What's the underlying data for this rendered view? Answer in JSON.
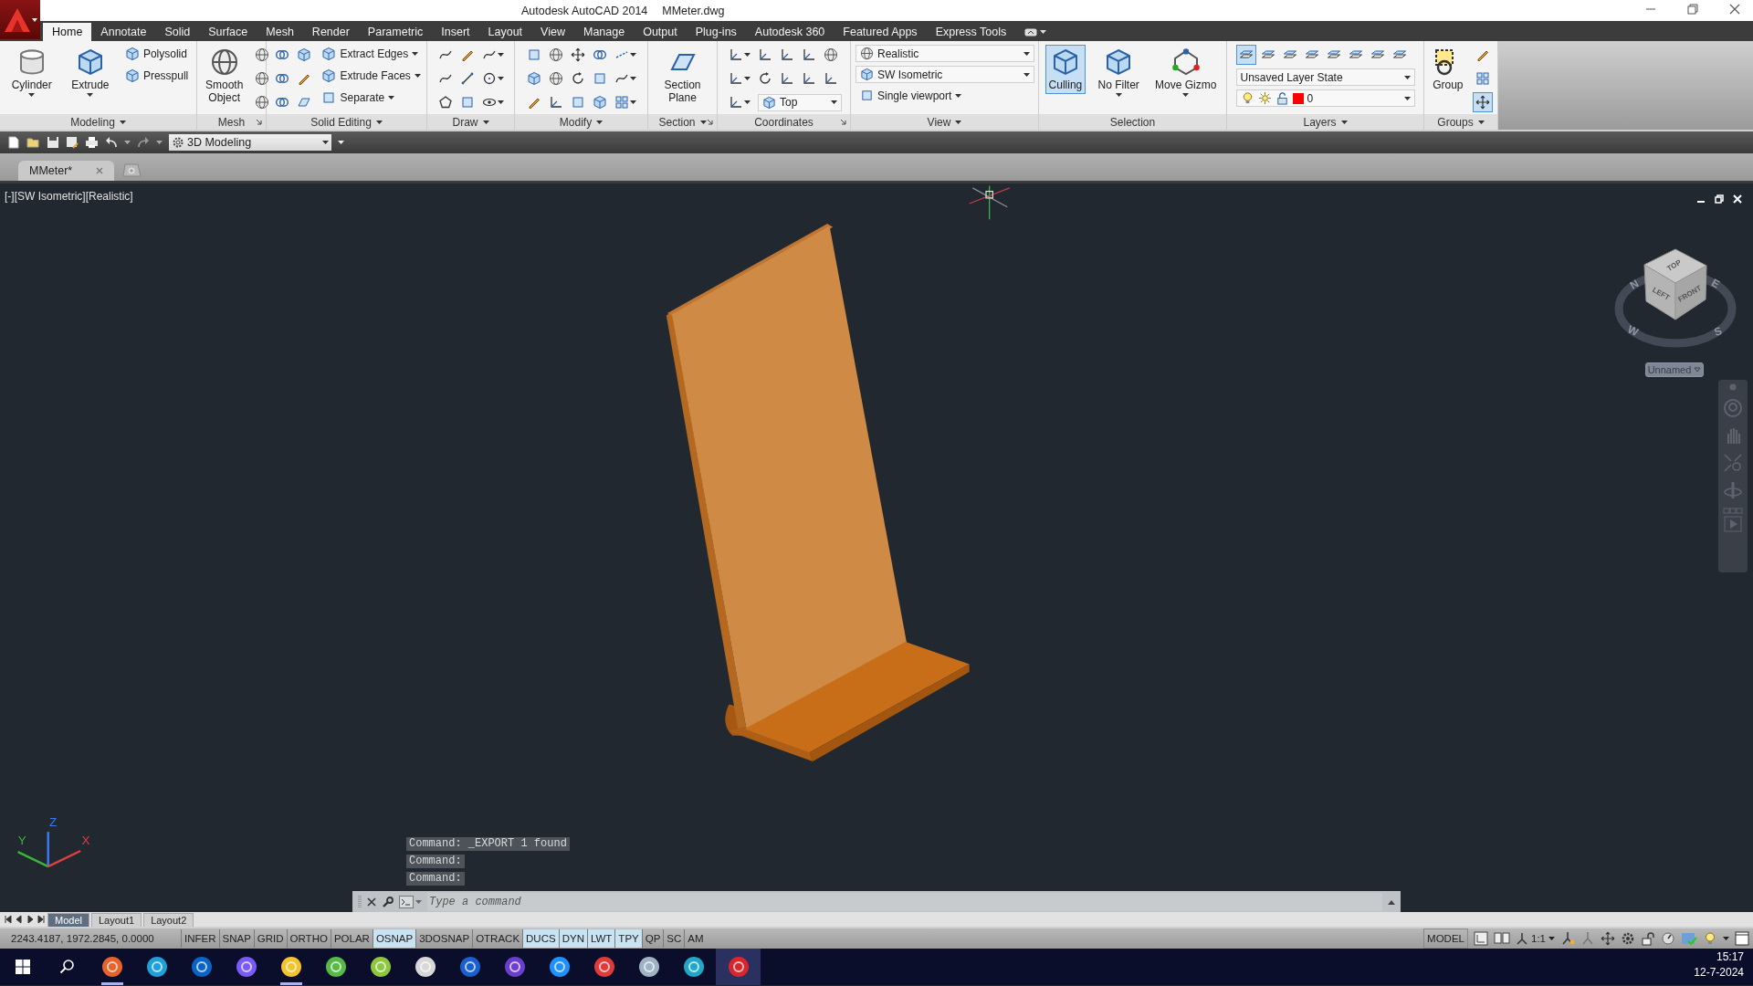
{
  "window": {
    "title": "Autodesk AutoCAD 2014",
    "file": "MMeter.dwg"
  },
  "ribbon_tabs": [
    {
      "label": "Home",
      "selected": true
    },
    {
      "label": "Annotate",
      "selected": false
    },
    {
      "label": "Solid",
      "selected": false
    },
    {
      "label": "Surface",
      "selected": false
    },
    {
      "label": "Mesh",
      "selected": false
    },
    {
      "label": "Render",
      "selected": false
    },
    {
      "label": "Parametric",
      "selected": false
    },
    {
      "label": "Insert",
      "selected": false
    },
    {
      "label": "Layout",
      "selected": false
    },
    {
      "label": "View",
      "selected": false
    },
    {
      "label": "Manage",
      "selected": false
    },
    {
      "label": "Output",
      "selected": false
    },
    {
      "label": "Plug-ins",
      "selected": false
    },
    {
      "label": "Autodesk 360",
      "selected": false
    },
    {
      "label": "Featured Apps",
      "selected": false
    },
    {
      "label": "Express Tools",
      "selected": false
    }
  ],
  "ribbon_panels": [
    {
      "title": "Modeling",
      "menu": true,
      "launcher": false,
      "controls": [
        {
          "kind": "large",
          "label": "Cylinder",
          "dropdown": true
        },
        {
          "kind": "large",
          "label": "Extrude",
          "dropdown": true
        },
        {
          "kind": "small_col",
          "items": [
            {
              "label": "Polysolid",
              "dropdown": false
            },
            {
              "label": "Presspull",
              "dropdown": false
            }
          ]
        }
      ]
    },
    {
      "title": "Mesh",
      "menu": false,
      "launcher": true,
      "controls": [
        {
          "kind": "large",
          "label": "Smooth\nObject",
          "dropdown": false
        },
        {
          "kind": "icons",
          "rows": [
            {
              "buttons": [
                {
                  "dropdown": false
                }
              ]
            },
            {
              "buttons": [
                {
                  "dropdown": false
                }
              ]
            },
            {
              "buttons": [
                {
                  "dropdown": false
                }
              ]
            }
          ]
        }
      ]
    },
    {
      "title": "Solid Editing",
      "menu": true,
      "launcher": false,
      "controls": [
        {
          "kind": "icons",
          "rows": [
            {
              "buttons": [
                {
                  "dropdown": false
                },
                {
                  "dropdown": false
                }
              ]
            },
            {
              "buttons": [
                {
                  "dropdown": false
                },
                {
                  "dropdown": false
                }
              ]
            },
            {
              "buttons": [
                {
                  "dropdown": false
                },
                {
                  "dropdown": false
                }
              ]
            }
          ]
        },
        {
          "kind": "small_col",
          "items": [
            {
              "label": "Extract Edges",
              "dropdown": true
            },
            {
              "label": "Extrude Faces",
              "dropdown": true
            },
            {
              "label": "Separate",
              "dropdown": true
            }
          ]
        }
      ]
    },
    {
      "title": "Draw",
      "menu": true,
      "launcher": false,
      "controls": [
        {
          "kind": "icons",
          "rows": [
            {
              "buttons": [
                {
                  "dropdown": false
                },
                {
                  "dropdown": false
                },
                {
                  "dropdown": true
                }
              ]
            },
            {
              "buttons": [
                {
                  "dropdown": false
                },
                {
                  "dropdown": false
                },
                {
                  "dropdown": true
                }
              ]
            },
            {
              "buttons": [
                {
                  "dropdown": false
                },
                {
                  "dropdown": false
                },
                {
                  "dropdown": true
                }
              ]
            }
          ]
        }
      ]
    },
    {
      "title": "Modify",
      "menu": true,
      "launcher": false,
      "controls": [
        {
          "kind": "icons",
          "rows": [
            {
              "buttons": [
                {
                  "dropdown": false
                },
                {
                  "dropdown": false
                },
                {
                  "dropdown": false
                },
                {
                  "dropdown": false
                },
                {
                  "dropdown": true
                }
              ]
            },
            {
              "buttons": [
                {
                  "dropdown": false
                },
                {
                  "dropdown": false
                },
                {
                  "dropdown": false
                },
                {
                  "dropdown": false
                },
                {
                  "dropdown": true
                }
              ]
            },
            {
              "buttons": [
                {
                  "dropdown": false
                },
                {
                  "dropdown": false
                },
                {
                  "dropdown": false
                },
                {
                  "dropdown": false
                },
                {
                  "dropdown": true
                }
              ]
            }
          ]
        }
      ]
    },
    {
      "title": "Section",
      "menu": true,
      "launcher": true,
      "controls": [
        {
          "kind": "large",
          "label": "Section\nPlane",
          "dropdown": false
        }
      ]
    },
    {
      "title": "Coordinates",
      "menu": false,
      "launcher": true,
      "controls": [
        {
          "kind": "icons",
          "rows": [
            {
              "buttons": [
                {
                  "dropdown": true
                },
                {
                  "dropdown": false
                },
                {
                  "dropdown": false
                },
                {
                  "dropdown": false
                },
                {
                  "dropdown": false
                }
              ]
            },
            {
              "buttons": [
                {
                  "dropdown": true
                },
                {
                  "dropdown": false
                },
                {
                  "dropdown": false
                },
                {
                  "dropdown": false
                },
                {
                  "dropdown": false
                }
              ]
            },
            {
              "buttons": [
                {
                  "dropdown": true
                }
              ],
              "combo": {
                "kind": "icon_combo",
                "text": "Top"
              }
            }
          ]
        }
      ]
    },
    {
      "title": "View",
      "menu": true,
      "launcher": false,
      "controls": [
        {
          "kind": "stack",
          "children": [
            {
              "kind": "icon_combo",
              "text": "Realistic"
            },
            {
              "kind": "icon_combo",
              "text": "SW Isometric"
            },
            {
              "kind": "menu",
              "text": "Single viewport"
            }
          ]
        }
      ]
    },
    {
      "title": "Selection",
      "menu": false,
      "launcher": false,
      "controls": [
        {
          "kind": "large",
          "label": "Culling",
          "dropdown": false,
          "on": true
        },
        {
          "kind": "large",
          "label": "No Filter",
          "dropdown": true,
          "on": false
        },
        {
          "kind": "large",
          "label": "Move Gizmo",
          "dropdown": true,
          "on": false
        }
      ]
    },
    {
      "title": "Layers",
      "menu": true,
      "launcher": false,
      "controls": [
        {
          "kind": "stack",
          "children": [
            {
              "kind": "icons",
              "rows": [
                {
                  "buttons": [
                    {
                      "on": true
                    },
                    {
                      "on": false
                    },
                    {
                      "on": false
                    },
                    {
                      "on": false
                    },
                    {
                      "on": false
                    },
                    {
                      "on": false
                    },
                    {
                      "on": false
                    },
                    {
                      "on": false
                    }
                  ]
                }
              ]
            },
            {
              "kind": "combo",
              "text": "Unsaved Layer State"
            },
            {
              "kind": "layer",
              "text": "0",
              "color": "#ff0000"
            }
          ]
        }
      ]
    },
    {
      "title": "Groups",
      "menu": true,
      "launcher": false,
      "controls": [
        {
          "kind": "large",
          "label": "Group",
          "dropdown": false,
          "on": false
        },
        {
          "kind": "icons",
          "rows": [
            {
              "buttons": [
                {
                  "on": false
                }
              ]
            },
            {
              "buttons": [
                {
                  "on": false
                }
              ]
            },
            {
              "buttons": [
                {
                  "on": true
                }
              ]
            }
          ]
        }
      ]
    }
  ],
  "quick_access": {
    "workspace": "3D Modeling"
  },
  "file_tabs": [
    {
      "label": "MMeter*",
      "selected": true
    }
  ],
  "viewport": {
    "label_parts": [
      "[-]",
      "[SW Isometric]",
      "[Realistic]"
    ],
    "ucs_axes": [
      "X",
      "Y",
      "Z"
    ],
    "viewcube": {
      "faces": [
        "TOP",
        "LEFT",
        "FRONT"
      ],
      "compass": [
        "N",
        "E",
        "S",
        "W"
      ],
      "ucs": "Unnamed"
    }
  },
  "command_history": [
    "Command: _EXPORT 1 found",
    "Command:",
    "Command:"
  ],
  "command_line": {
    "placeholder": "Type a command"
  },
  "layout_tabs": [
    {
      "label": "Model",
      "selected": true
    },
    {
      "label": "Layout1",
      "selected": false
    },
    {
      "label": "Layout2",
      "selected": false
    }
  ],
  "status_bar": {
    "coordinates": "2243.4187, 1972.2845, 0.0000",
    "toggles": [
      {
        "label": "INFER",
        "on": false
      },
      {
        "label": "SNAP",
        "on": false
      },
      {
        "label": "GRID",
        "on": false
      },
      {
        "label": "ORTHO",
        "on": false
      },
      {
        "label": "POLAR",
        "on": false
      },
      {
        "label": "OSNAP",
        "on": true
      },
      {
        "label": "3DOSNAP",
        "on": false
      },
      {
        "label": "OTRACK",
        "on": false
      },
      {
        "label": "DUCS",
        "on": true
      },
      {
        "label": "DYN",
        "on": true
      },
      {
        "label": "LWT",
        "on": true
      },
      {
        "label": "TPY",
        "on": true
      },
      {
        "label": "QP",
        "on": false
      },
      {
        "label": "SC",
        "on": false
      },
      {
        "label": "AM",
        "on": false
      }
    ],
    "space": "MODEL",
    "scale": "1:1"
  },
  "taskbar": {
    "apps": [
      {
        "color": "#e8632b",
        "running": true,
        "focused": false
      },
      {
        "color": "#1fa0d8",
        "running": false,
        "focused": false
      },
      {
        "color": "#0a64c8",
        "running": false,
        "focused": false
      },
      {
        "color": "#7a5af8",
        "running": false,
        "focused": false
      },
      {
        "color": "#f3c430",
        "running": true,
        "focused": false
      },
      {
        "color": "#58b947",
        "running": false,
        "focused": false
      },
      {
        "color": "#8dc63f",
        "running": false,
        "focused": false
      },
      {
        "color": "#d8d8d8",
        "running": false,
        "focused": false
      },
      {
        "color": "#1a5fd0",
        "running": false,
        "focused": false
      },
      {
        "color": "#6a3fd0",
        "running": false,
        "focused": false
      },
      {
        "color": "#1e90ff",
        "running": false,
        "focused": false
      },
      {
        "color": "#e03a3a",
        "running": false,
        "focused": false
      },
      {
        "color": "#9fb3c4",
        "running": false,
        "focused": false
      },
      {
        "color": "#1fa8c8",
        "running": false,
        "focused": false
      },
      {
        "color": "#d8262c",
        "running": true,
        "focused": true
      }
    ],
    "time": "15:17",
    "date": "12-7-2024"
  }
}
